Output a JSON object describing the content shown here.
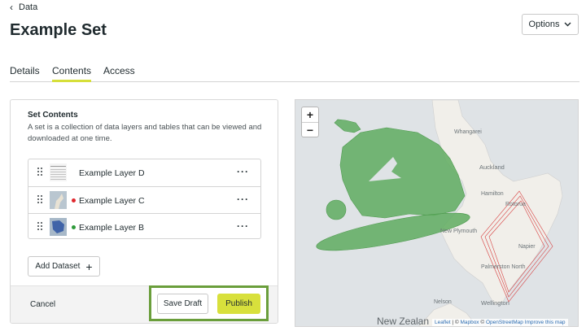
{
  "breadcrumb": {
    "label": "Data"
  },
  "page": {
    "title": "Example Set"
  },
  "options_button": {
    "label": "Options"
  },
  "tabs": [
    {
      "label": "Details",
      "active": false
    },
    {
      "label": "Contents",
      "active": true
    },
    {
      "label": "Access",
      "active": false
    }
  ],
  "set_contents": {
    "heading": "Set Contents",
    "description": "A set is a collection of data layers and tables that can be viewed and downloaded at one time.",
    "layers": [
      {
        "name": "Example Layer D",
        "status_color": null,
        "thumb": "table"
      },
      {
        "name": "Example Layer C",
        "status_color": "#e0282e",
        "thumb": "map"
      },
      {
        "name": "Example Layer B",
        "status_color": "#2e9a3a",
        "thumb": "map-blue"
      }
    ],
    "add_dataset_label": "Add Dataset",
    "add_icon": "+"
  },
  "footer": {
    "cancel_label": "Cancel",
    "save_draft_label": "Save Draft",
    "publish_label": "Publish"
  },
  "map": {
    "zoom_in": "+",
    "zoom_out": "−",
    "places": [
      "Whangarei",
      "Auckland",
      "Hamilton",
      "Rotorua",
      "New Plymouth",
      "Napier",
      "Palmerston North",
      "Nelson",
      "Wellington"
    ],
    "country_label": "New Zealan",
    "attribution": {
      "leaflet": "Leaflet",
      "sep1": " | © ",
      "mapbox": "Mapbox",
      "sep2": " © ",
      "osm": "OpenStreetMap",
      "improve": "Improve this map"
    }
  },
  "colors": {
    "accent": "#d8e03c",
    "highlight_border": "#6a9e3b",
    "polygon_fill": "#5fac5f"
  }
}
